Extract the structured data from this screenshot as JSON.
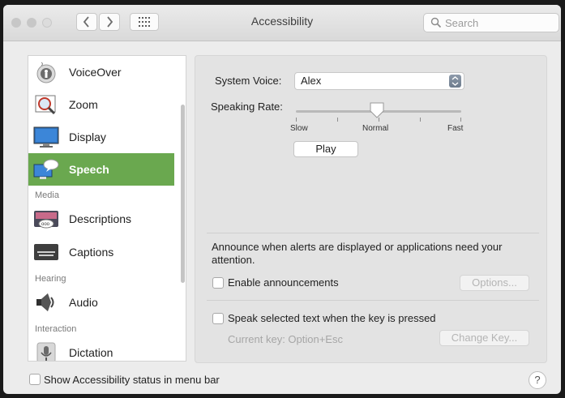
{
  "window": {
    "title": "Accessibility",
    "traffic_light_colors": [
      "#c7c7c7",
      "#c7c7c7",
      "#dcdcdc"
    ]
  },
  "toolbar": {
    "back_icon": "chevron-left-icon",
    "forward_icon": "chevron-right-icon",
    "show_all_icon": "grid-icon",
    "search_placeholder": "Search"
  },
  "sidebar": {
    "items": [
      {
        "label": "VoiceOver",
        "icon": "voiceover-icon"
      },
      {
        "label": "Zoom",
        "icon": "zoom-icon"
      },
      {
        "label": "Display",
        "icon": "display-icon"
      },
      {
        "label": "Speech",
        "icon": "speech-icon",
        "selected": true
      },
      {
        "label": "Descriptions",
        "icon": "descriptions-icon"
      },
      {
        "label": "Captions",
        "icon": "captions-icon"
      },
      {
        "label": "Audio",
        "icon": "audio-icon"
      },
      {
        "label": "Dictation",
        "icon": "dictation-icon"
      }
    ],
    "headers": [
      "Media",
      "Hearing",
      "Interaction"
    ],
    "selected_color": "#6aa84f"
  },
  "speech": {
    "system_voice_label": "System Voice:",
    "system_voice_value": "Alex",
    "speaking_rate_label": "Speaking Rate:",
    "rate_slow": "Slow",
    "rate_normal": "Normal",
    "rate_fast": "Fast",
    "rate_value": 0.5,
    "play_label": "Play",
    "announce_text": "Announce when alerts are displayed or applications need your attention.",
    "enable_announcements_label": "Enable announcements",
    "enable_announcements_checked": false,
    "options_label": "Options...",
    "speak_selected_label": "Speak selected text when the key is pressed",
    "speak_selected_checked": false,
    "current_key_label": "Current key: Option+Esc",
    "change_key_label": "Change Key..."
  },
  "footer": {
    "show_status_label": "Show Accessibility status in menu bar",
    "show_status_checked": false,
    "help_label": "?"
  }
}
